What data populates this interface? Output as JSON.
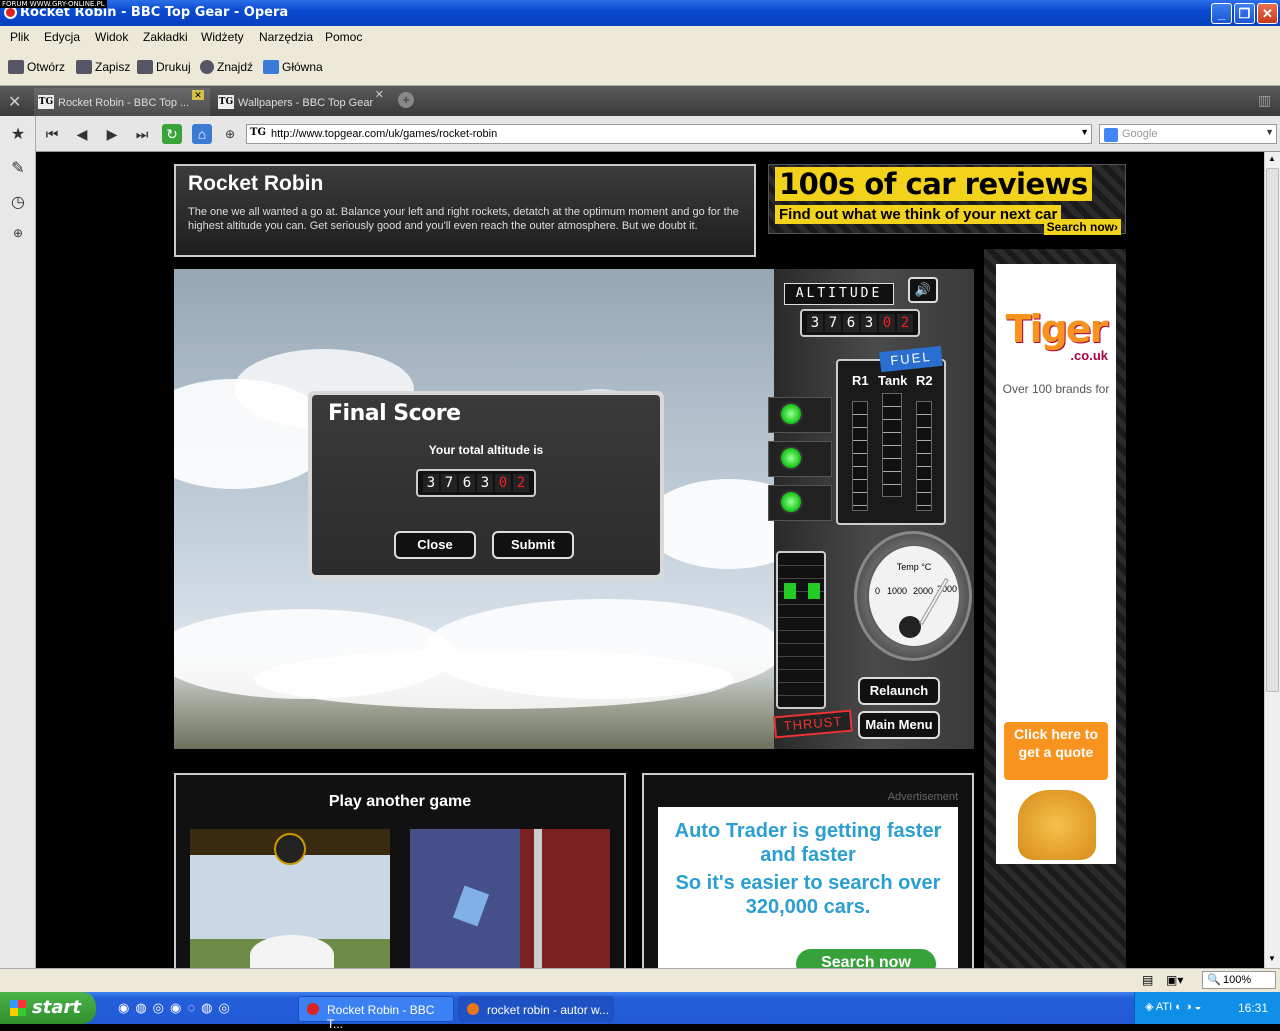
{
  "watermark": "FORUM WWW.GRY-ONLINE.PL",
  "window": {
    "title": "Rocket Robin - BBC Top Gear - Opera"
  },
  "menu": [
    "Plik",
    "Edycja",
    "Widok",
    "Zakładki",
    "Widżety",
    "Narzędzia",
    "Pomoc"
  ],
  "toolbar": {
    "open": "Otwórz",
    "save": "Zapisz",
    "print": "Drukuj",
    "find": "Znajdź",
    "home": "Główna"
  },
  "tabs": [
    {
      "label": "Rocket Robin - BBC Top ..."
    },
    {
      "label": "Wallpapers - BBC Top Gear"
    }
  ],
  "address": {
    "tg": "TG",
    "url": "http://www.topgear.com/uk/games/rocket-robin",
    "search_placeholder": "Google"
  },
  "page": {
    "title": "Rocket Robin",
    "description": "The one we all wanted a go at. Balance your left and right rockets, detatch at the optimum moment and go for the highest altitude you can. Get seriously good and you'll even reach the outer atmosphere. But we doubt it.",
    "reviews_ad": {
      "line1": "100s of car reviews",
      "line2": "Find out what we think of your next car",
      "cta": "Search now›"
    }
  },
  "game": {
    "altitude_label": "ALTITUDE",
    "altitude_digits": [
      "3",
      "7",
      "6",
      "3",
      "0",
      "2"
    ],
    "fuel_label": "FUEL",
    "fuel_cols": [
      "R1",
      "Tank",
      "R2"
    ],
    "temp_label": "Temp °C",
    "temp_ticks": [
      "0",
      "1000",
      "2000",
      "3000"
    ],
    "thrust_label": "THRUST",
    "relaunch": "Relaunch",
    "main_menu": "Main Menu",
    "dialog": {
      "title": "Final Score",
      "subtitle": "Your total altitude is",
      "digits": [
        "3",
        "7",
        "6",
        "3",
        "0",
        "2"
      ],
      "close": "Close",
      "submit": "Submit"
    }
  },
  "play_another": {
    "title": "Play another game"
  },
  "advert": {
    "label": "Advertisement",
    "line1": "Auto Trader is getting faster and faster",
    "line2": "So it's easier to search over 320,000 cars.",
    "cta": "Search now"
  },
  "tiger_ad": {
    "brand": "Tiger",
    ".co.uk": ".co.uk",
    "text": "Over 100 brands for",
    "quote": "Click here to get a quote"
  },
  "status": {
    "zoom": "100%"
  },
  "taskbar": {
    "start": "start",
    "tasks": [
      "Rocket Robin - BBC T...",
      "rocket robin - autor w..."
    ],
    "clock": "16:31"
  },
  "colors": {
    "accent_yellow": "#f2d21a",
    "tiger_orange": "#f7931e",
    "autotrader_blue": "#2a9fd0",
    "xp_blue": "#245edb"
  }
}
